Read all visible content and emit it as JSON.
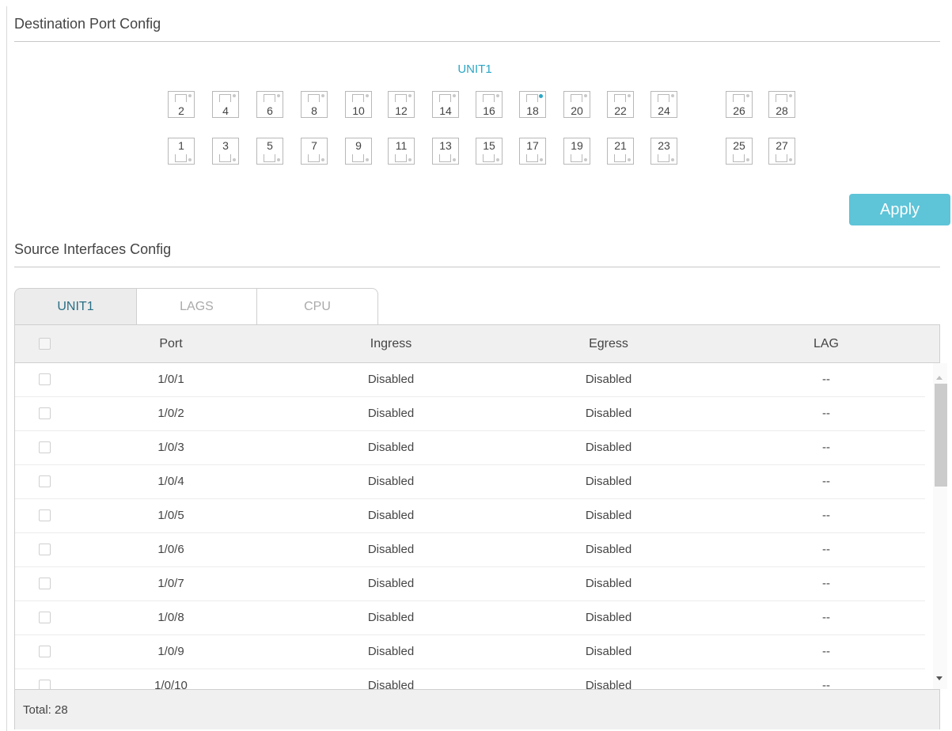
{
  "destination": {
    "title": "Destination Port Config",
    "unit_label": "UNIT1",
    "top_ports": [
      "2",
      "4",
      "6",
      "8",
      "10",
      "12",
      "14",
      "16",
      "18",
      "20",
      "22",
      "24",
      "26",
      "28"
    ],
    "bottom_ports": [
      "1",
      "3",
      "5",
      "7",
      "9",
      "11",
      "13",
      "15",
      "17",
      "19",
      "21",
      "23",
      "25",
      "27"
    ],
    "selected_port": "18",
    "apply_label": "Apply"
  },
  "source": {
    "title": "Source Interfaces Config",
    "tabs": [
      "UNIT1",
      "LAGS",
      "CPU"
    ],
    "active_tab": "UNIT1",
    "columns": [
      "Port",
      "Ingress",
      "Egress",
      "LAG"
    ],
    "rows": [
      {
        "port": "1/0/1",
        "ingress": "Disabled",
        "egress": "Disabled",
        "lag": "--"
      },
      {
        "port": "1/0/2",
        "ingress": "Disabled",
        "egress": "Disabled",
        "lag": "--"
      },
      {
        "port": "1/0/3",
        "ingress": "Disabled",
        "egress": "Disabled",
        "lag": "--"
      },
      {
        "port": "1/0/4",
        "ingress": "Disabled",
        "egress": "Disabled",
        "lag": "--"
      },
      {
        "port": "1/0/5",
        "ingress": "Disabled",
        "egress": "Disabled",
        "lag": "--"
      },
      {
        "port": "1/0/6",
        "ingress": "Disabled",
        "egress": "Disabled",
        "lag": "--"
      },
      {
        "port": "1/0/7",
        "ingress": "Disabled",
        "egress": "Disabled",
        "lag": "--"
      },
      {
        "port": "1/0/8",
        "ingress": "Disabled",
        "egress": "Disabled",
        "lag": "--"
      },
      {
        "port": "1/0/9",
        "ingress": "Disabled",
        "egress": "Disabled",
        "lag": "--"
      },
      {
        "port": "1/0/10",
        "ingress": "Disabled",
        "egress": "Disabled",
        "lag": "--"
      }
    ],
    "total_label": "Total: 28"
  },
  "colors": {
    "accent": "#2ba6c6",
    "apply_button": "#5ec4d8",
    "header_bg": "#f0f0f0"
  }
}
